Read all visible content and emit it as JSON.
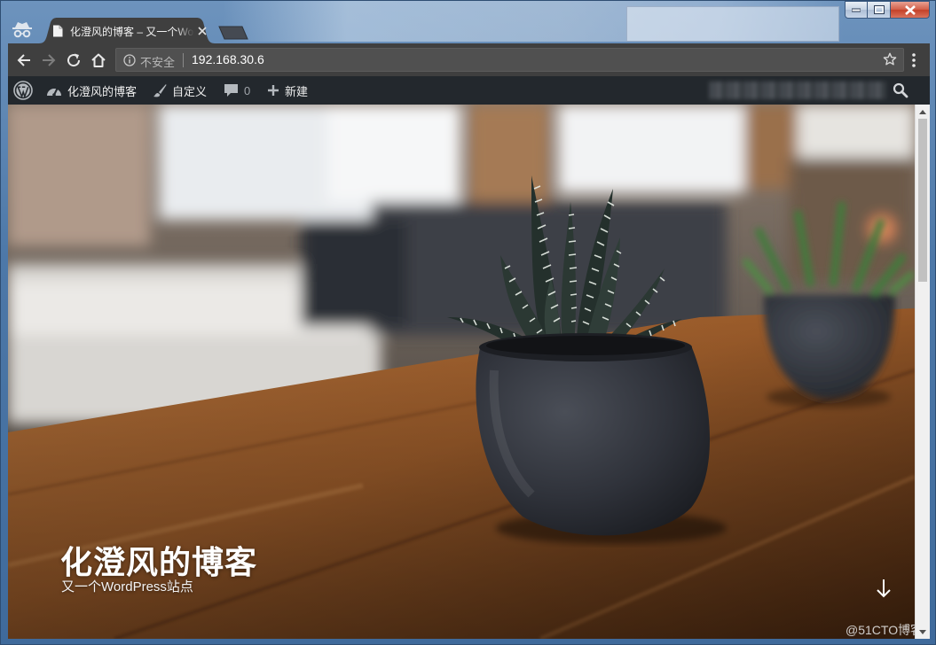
{
  "browser": {
    "tab_title": "化澄风的博客 – 又一个WordPress站点",
    "url": "192.168.30.6",
    "security_label": "不安全"
  },
  "admin_bar": {
    "site_name": "化澄风的博客",
    "customize": "自定义",
    "comments_count": "0",
    "new": "新建"
  },
  "hero": {
    "site_title": "化澄风的博客",
    "site_description": "又一个WordPress站点"
  },
  "watermark": "@51CTO博客",
  "icons": {
    "incognito": "incognito-icon",
    "favicon": "page-icon",
    "back": "arrow-left-icon",
    "forward": "arrow-right-icon",
    "reload": "reload-icon",
    "home": "home-icon",
    "info": "info-icon",
    "bookmark": "star-icon",
    "menu": "vertical-dots-icon",
    "wordpress": "wordpress-logo-icon",
    "dashboard": "dashboard-icon",
    "customize": "paintbrush-icon",
    "comments": "speech-bubble-icon",
    "new": "plus-icon",
    "search": "search-icon",
    "scroll_down": "arrow-down-icon"
  },
  "colors": {
    "admin_bar": "#23282d",
    "toolbar": "#3f3f3f",
    "omnibox": "#505050",
    "title_text": "#ffffff"
  }
}
